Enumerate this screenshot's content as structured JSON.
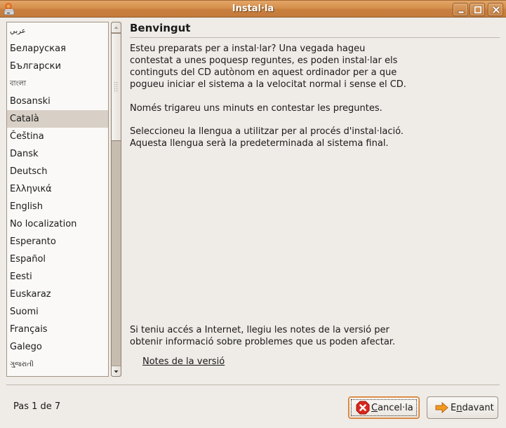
{
  "window": {
    "title": "Instal·la",
    "controls": [
      "minimize",
      "maximize",
      "close"
    ]
  },
  "languages": {
    "selected": "Català",
    "items": [
      {
        "label": "عربي",
        "small": true
      },
      {
        "label": "Беларуская"
      },
      {
        "label": "Български"
      },
      {
        "label": "বাংলা",
        "small": true
      },
      {
        "label": "Bosanski"
      },
      {
        "label": "Català",
        "selected": true
      },
      {
        "label": "Čeština"
      },
      {
        "label": "Dansk"
      },
      {
        "label": "Deutsch"
      },
      {
        "label": "Ελληνικά"
      },
      {
        "label": "English"
      },
      {
        "label": "No localization"
      },
      {
        "label": "Esperanto"
      },
      {
        "label": "Español"
      },
      {
        "label": "Eesti"
      },
      {
        "label": "Euskaraz"
      },
      {
        "label": "Suomi"
      },
      {
        "label": "Français"
      },
      {
        "label": "Galego"
      },
      {
        "label": "ગુજરાતી",
        "small": true
      }
    ]
  },
  "main": {
    "heading": "Benvingut",
    "paragraph1": "Esteu preparats per a instal·lar? Una vegada hageu contestat a unes poquesp reguntes, es poden instal·lar els continguts del CD autònom en aquest ordinador per a que pogueu iniciar el sistema a la velocitat normal i sense el CD.",
    "paragraph1_lines": [
      "Esteu preparats per a instal·lar? Una vegada hageu",
      "contestat a unes poquesp reguntes, es poden instal·lar els",
      "continguts del CD autònom en aquest ordinador per a que",
      "pogueu iniciar el sistema a la velocitat normal i sense el CD."
    ],
    "paragraph2": "Només trigareu uns minuts en contestar les preguntes.",
    "paragraph3_lines": [
      "Seleccioneu la llengua a utilitzar per al procés d'instal·lació.",
      "Aquesta llengua serà la predeterminada al sistema final."
    ],
    "paragraph4_lines": [
      "Si teniu accés a Internet, llegiu les notes de la versió per",
      "obtenir informació sobre problemes que us poden afectar."
    ],
    "release_notes_link": "Notes de la versió"
  },
  "footer": {
    "step": "Pas 1 de 7",
    "cancel_label": "Cancel·la",
    "cancel_mnemonic": "C",
    "cancel_rest": "ancel·la",
    "next_label": "Endavant",
    "next_pre": "E",
    "next_mnemonic": "n",
    "next_rest": "davant"
  },
  "colors": {
    "titlebar": "#d58f4c",
    "selection": "#d8d0c7",
    "focus_border": "#d17a2c",
    "background": "#efebe7"
  }
}
